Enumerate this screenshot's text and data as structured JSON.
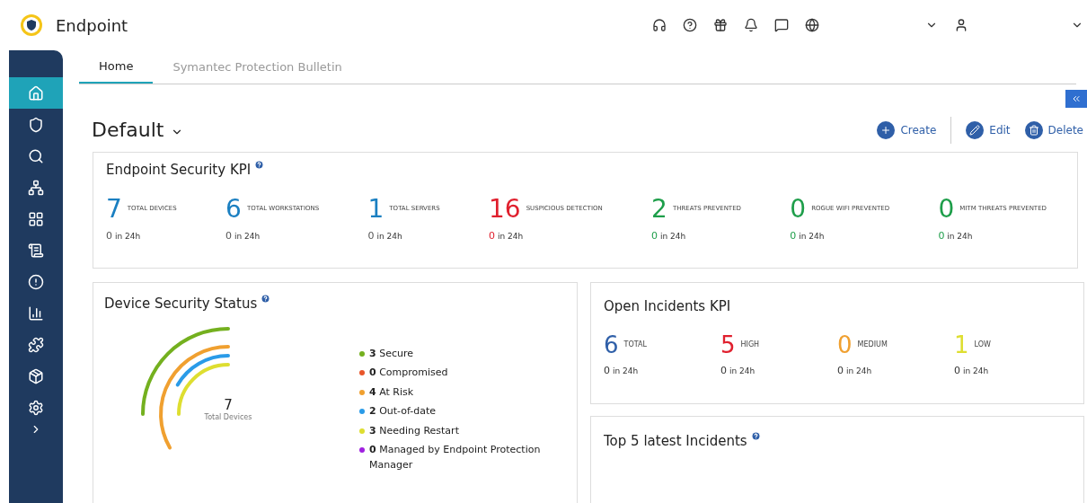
{
  "app": {
    "title": "Endpoint"
  },
  "sidebar": {
    "items": [
      {
        "kind": "home",
        "selected": true
      },
      {
        "kind": "shield",
        "selected": false
      },
      {
        "kind": "search",
        "selected": false
      },
      {
        "kind": "hierarchy",
        "selected": false
      },
      {
        "kind": "apps",
        "selected": false
      },
      {
        "kind": "document",
        "selected": false
      },
      {
        "kind": "alert",
        "selected": false
      },
      {
        "kind": "chart",
        "selected": false
      },
      {
        "kind": "puzzle",
        "selected": false
      },
      {
        "kind": "box",
        "selected": false
      },
      {
        "kind": "settings",
        "selected": false
      }
    ]
  },
  "tabs": [
    {
      "label": "Home",
      "selected": true
    },
    {
      "label": "Symantec Protection Bulletin",
      "selected": false
    }
  ],
  "dashboard": {
    "title": "Default",
    "actions": [
      {
        "kind": "create",
        "label": "Create"
      },
      {
        "kind": "edit",
        "label": "Edit"
      },
      {
        "kind": "delete",
        "label": "Delete"
      }
    ]
  },
  "endpoint_kpi": {
    "title": "Endpoint Security KPI",
    "items": [
      {
        "value": "7",
        "label": "TOTAL DEVICES",
        "sub_value": "0",
        "sub_text": "in 24h",
        "color": "#1a7fc1",
        "sub_colored": false
      },
      {
        "value": "6",
        "label": "TOTAL WORKSTATIONS",
        "sub_value": "0",
        "sub_text": "in 24h",
        "color": "#1a7fc1",
        "sub_colored": false
      },
      {
        "value": "1",
        "label": "TOTAL SERVERS",
        "sub_value": "0",
        "sub_text": "in 24h",
        "color": "#1a7fc1",
        "sub_colored": false
      },
      {
        "value": "16",
        "label": "SUSPICIOUS DETECTION",
        "sub_value": "0",
        "sub_text": "in 24h",
        "color": "#e0202e",
        "sub_colored": true
      },
      {
        "value": "2",
        "label": "THREATS PREVENTED",
        "sub_value": "0",
        "sub_text": "in 24h",
        "color": "#1e9e4a",
        "sub_colored": true
      },
      {
        "value": "0",
        "label": "ROGUE WIFI PREVENTED",
        "sub_value": "0",
        "sub_text": "in 24h",
        "color": "#1e9e4a",
        "sub_colored": true
      },
      {
        "value": "0",
        "label": "MITM THREATS PREVENTED",
        "sub_value": "0",
        "sub_text": "in 24h",
        "color": "#1e9e4a",
        "sub_colored": true
      }
    ]
  },
  "device_status": {
    "title": "Device Security Status",
    "center_value": "7",
    "center_label": "Total Devices",
    "legend": [
      {
        "count": "3",
        "label": "Secure",
        "color": "#74b01f"
      },
      {
        "count": "0",
        "label": "Compromised",
        "color": "#e8562a"
      },
      {
        "count": "4",
        "label": "At Risk",
        "color": "#f0a030"
      },
      {
        "count": "2",
        "label": "Out-of-date",
        "color": "#2a9be8"
      },
      {
        "count": "3",
        "label": "Needing Restart",
        "color": "#dede30"
      },
      {
        "count": "0",
        "label": "Managed by Endpoint Protection Manager",
        "color": "#a020e0"
      }
    ]
  },
  "incidents_kpi": {
    "title": "Open Incidents KPI",
    "items": [
      {
        "value": "6",
        "label": "TOTAL",
        "sub_value": "0",
        "sub_text": "in 24h",
        "color": "#2f5fa8"
      },
      {
        "value": "5",
        "label": "HIGH",
        "sub_value": "0",
        "sub_text": "in 24h",
        "color": "#e0202e"
      },
      {
        "value": "0",
        "label": "MEDIUM",
        "sub_value": "0",
        "sub_text": "in 24h",
        "color": "#f0a030"
      },
      {
        "value": "1",
        "label": "LOW",
        "sub_value": "0",
        "sub_text": "in 24h",
        "color": "#dede30"
      }
    ]
  },
  "latest_incidents": {
    "title": "Top 5 latest Incidents"
  }
}
